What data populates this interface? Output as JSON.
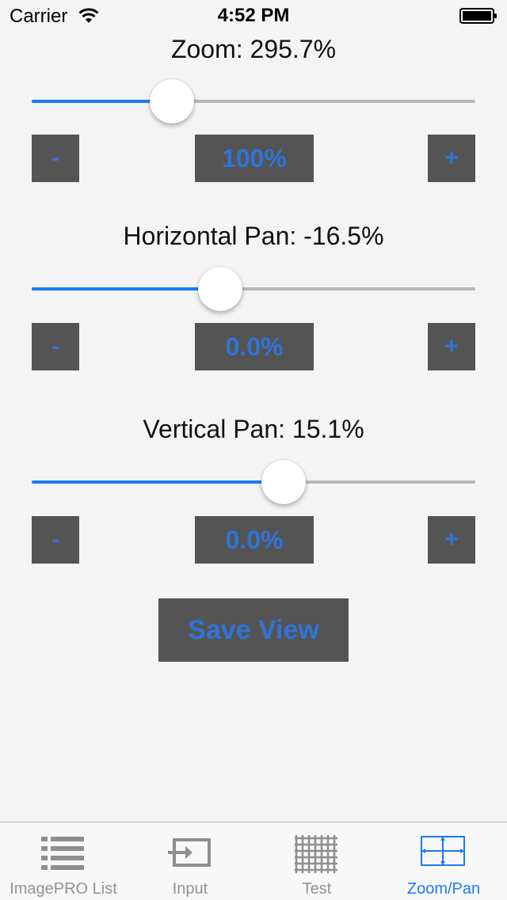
{
  "status_bar": {
    "carrier": "Carrier",
    "time": "4:52 PM"
  },
  "zoom": {
    "label": "Zoom: 295.7%",
    "slider_fraction": 0.316,
    "minus": "-",
    "value": "100%",
    "plus": "+"
  },
  "horizontal_pan": {
    "label": "Horizontal Pan: -16.5%",
    "slider_fraction": 0.425,
    "minus": "-",
    "value": "0.0%",
    "plus": "+"
  },
  "vertical_pan": {
    "label": "Vertical Pan: 15.1%",
    "slider_fraction": 0.568,
    "minus": "-",
    "value": "0.0%",
    "plus": "+"
  },
  "save_button": "Save View",
  "tabs": [
    {
      "label": "ImagePRO List",
      "icon": "list-icon",
      "active": false
    },
    {
      "label": "Input",
      "icon": "input-icon",
      "active": false
    },
    {
      "label": "Test",
      "icon": "grid-icon",
      "active": false
    },
    {
      "label": "Zoom/Pan",
      "icon": "zoom-pan-icon",
      "active": true
    }
  ],
  "colors": {
    "accent": "#1a7cf2",
    "button_bg": "#545454",
    "button_text": "#2f74d8",
    "background": "#f4f4f4"
  }
}
